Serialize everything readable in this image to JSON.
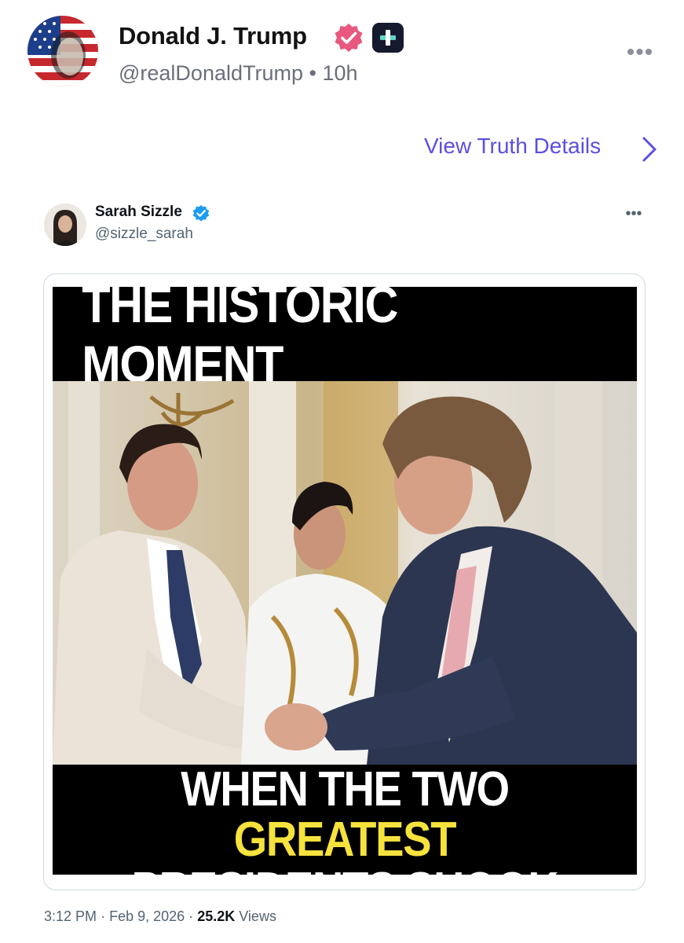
{
  "truth": {
    "author_name": "Donald J. Trump",
    "author_handle": "@realDonaldTrump",
    "separator": "•",
    "time_ago": "10h",
    "view_details_label": "View Truth Details",
    "more_label": "•••"
  },
  "embedded_post": {
    "author_name": "Sarah Sizzle",
    "author_handle": "@sizzle_sarah",
    "more_label": "•••",
    "meme": {
      "top_text": "THE HISTORIC MOMENT",
      "bottom_line1_prefix": "WHEN THE TWO ",
      "bottom_line1_highlight": "GREATEST",
      "bottom_line2": "PRESIDENTS SHOOK HANDS"
    },
    "time": "3:12 PM",
    "date": "Feb 9, 2026",
    "views_count": "25.2K",
    "views_label": "Views",
    "dot": "·"
  },
  "colors": {
    "verified_truth": "#e8587f",
    "verified_x": "#1d9bf0",
    "link": "#5b4fe0",
    "meme_highlight": "#f6e23d"
  },
  "icons": {
    "verified_truth": "verified-badge-icon",
    "plus": "plus-badge-icon",
    "chevron": "chevron-right-icon",
    "verified_x": "verified-check-icon"
  }
}
